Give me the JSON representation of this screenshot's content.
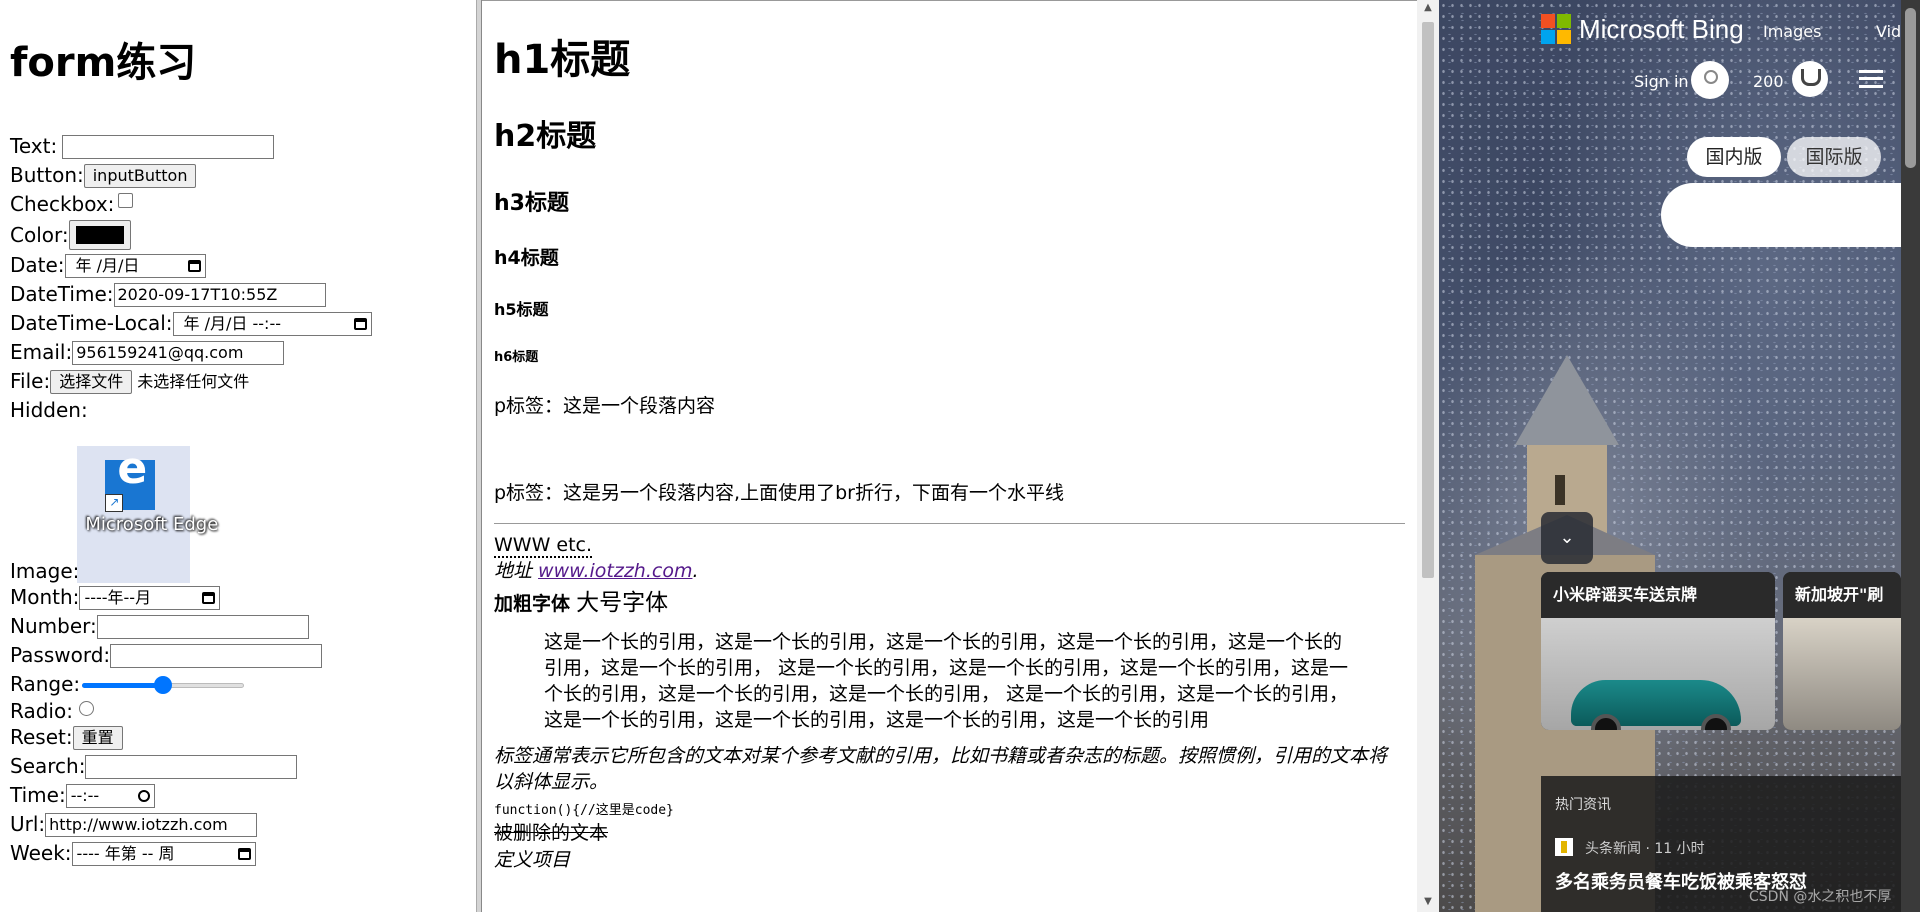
{
  "left": {
    "title": "form练习",
    "labels": {
      "text": "Text:",
      "button": "Button:",
      "checkbox": "Checkbox:",
      "color": "Color:",
      "date": "Date:",
      "datetime": "DateTime:",
      "datetime_local": "DateTime-Local:",
      "email": "Email:",
      "file": "File:",
      "hidden": "Hidden:",
      "image": "Image:",
      "month": "Month:",
      "number": "Number:",
      "password": "Password:",
      "range": "Range:",
      "radio": "Radio:",
      "reset": "Reset:",
      "search": "Search:",
      "time": "Time:",
      "url": "Url:",
      "week": "Week:"
    },
    "button_value": "inputButton",
    "color_value": "#000000",
    "date_value": "年 /月/日",
    "datetime_value": "2020-09-17T10:55Z",
    "datetime_local_value": "年 /月/日 --:--",
    "email_value": "956159241@qq.com",
    "file_button": "选择文件",
    "file_status": "未选择任何文件",
    "image_label": "Microsoft Edge",
    "month_value": "----年--月",
    "range_value_percent": 50,
    "reset_button": "重置",
    "time_value": "--:--",
    "url_value": "http://www.iotzzh.com",
    "week_value": "---- 年第 -- 周"
  },
  "mid": {
    "h1": "h1标题",
    "h2": "h2标题",
    "h3": "h3标题",
    "h4": "h4标题",
    "h5": "h5标题",
    "h6": "h6标题",
    "p1": "p标签：这是一个段落内容",
    "p2": "p标签：这是另一个段落内容,上面使用了br折行，下面有一个水平线",
    "abbr": "WWW etc.",
    "address_prefix": "地址 ",
    "address_link": "www.iotzzh.com",
    "address_suffix": ".",
    "bold": "加粗字体",
    "big": "大号字体",
    "blockquote": "这是一个长的引用，这是一个长的引用，这是一个长的引用，这是一个长的引用，这是一个长的引用，这是一个长的引用， 这是一个长的引用，这是一个长的引用，这是一个长的引用，这是一个长的引用，这是一个长的引用，这是一个长的引用， 这是一个长的引用，这是一个长的引用，这是一个长的引用，这是一个长的引用，这是一个长的引用，这是一个长的引用",
    "cite": "标签通常表示它所包含的文本对某个参考文献的引用，比如书籍或者杂志的标题。按照惯例，引用的文本将以斜体显示。",
    "code": "function(){//这里是code}",
    "deleted": "被删除的文本",
    "dfn": "定义项目"
  },
  "bing": {
    "brand": "Microsoft Bing",
    "nav_images": "Images",
    "nav_videos": "Videos",
    "sign_in": "Sign in",
    "points": "200",
    "tab_domestic": "国内版",
    "tab_international": "国际版",
    "card1_title": "小米辟谣买车送京牌",
    "card2_title": "新加坡开\"刷厕",
    "hot_header": "热门资讯",
    "hot_source": "头条新闻 · 11 小时",
    "hot_headline": "多名乘务员餐车吃饭被乘客怒怼",
    "watermark": "CSDN @水之积也不厚"
  }
}
